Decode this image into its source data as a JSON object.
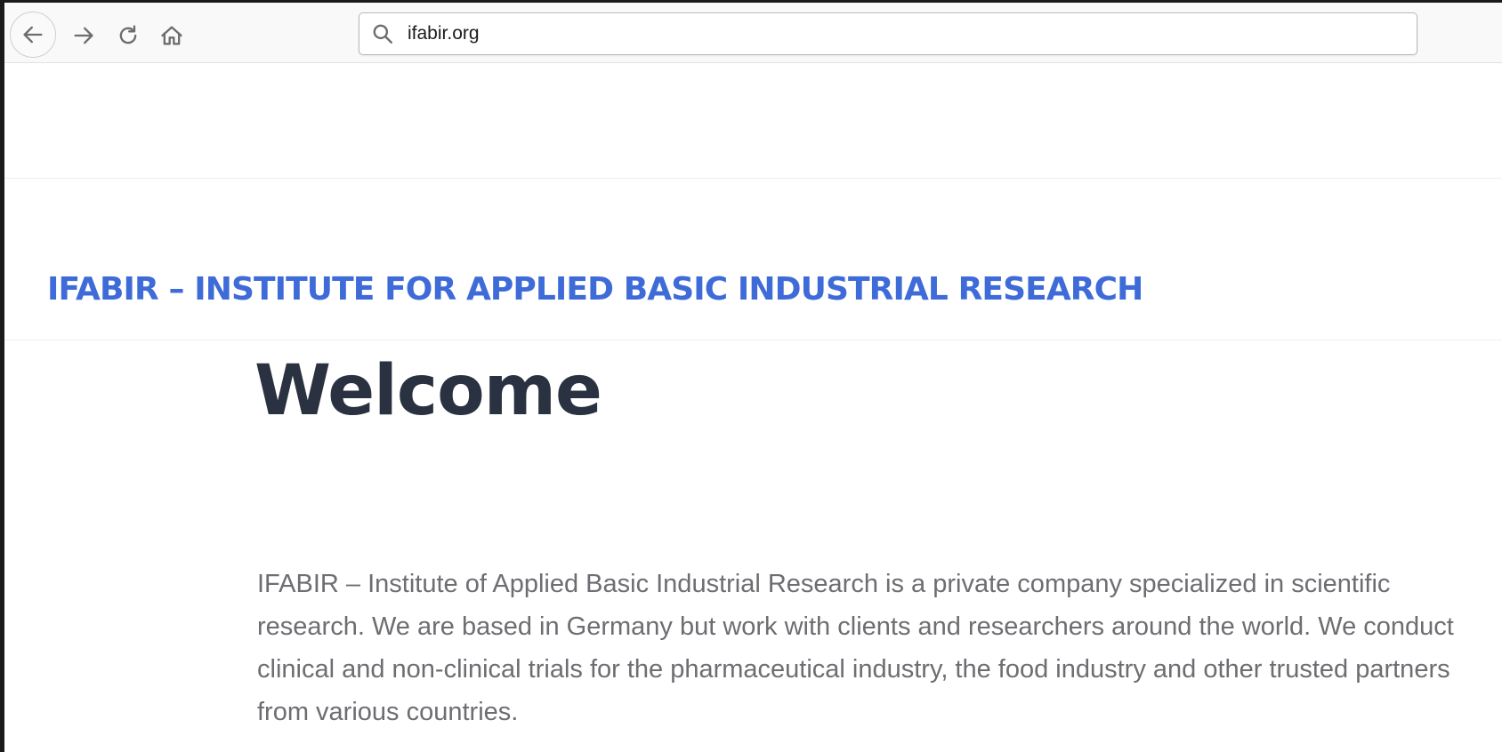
{
  "browser": {
    "url": "ifabir.org",
    "icons": {
      "back": "arrow-left-icon",
      "forward": "arrow-right-icon",
      "reload": "reload-icon",
      "home": "home-icon",
      "search": "search-icon"
    }
  },
  "site": {
    "title": "IFABIR – INSTITUTE FOR APPLIED BASIC INDUSTRIAL RESEARCH",
    "title_color": "#3e6bd8"
  },
  "content": {
    "heading": "Welcome",
    "intro_paragraph": "IFABIR – Institute of Applied Basic Industrial Research is a private company specialized in scientific research. We are based in Germany but work with clients and researchers around the world. We conduct clinical and non-clinical trials for the pharmaceutical industry, the food industry and other trusted partners from various countries."
  }
}
